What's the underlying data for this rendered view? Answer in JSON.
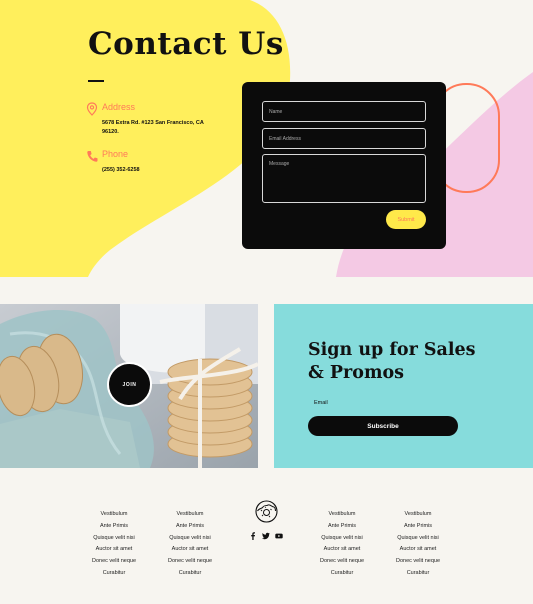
{
  "contact": {
    "title": "Contact Us",
    "address": {
      "label": "Address",
      "icon": "map-pin-icon",
      "line1": "5678 Extra Rd. #123 San Francisco, CA",
      "line2": "96120."
    },
    "phone": {
      "label": "Phone",
      "icon": "phone-icon",
      "number": "(255) 352-6258"
    },
    "form": {
      "name_placeholder": "Name",
      "email_placeholder": "Email Address",
      "message_placeholder": "Message",
      "submit_label": "Submit"
    }
  },
  "promo": {
    "join_label": "JOIN",
    "signup_title_line1": "Sign up for Sales",
    "signup_title_line2": "& Promos",
    "email_label": "Email",
    "subscribe_label": "Subscribe"
  },
  "footer": {
    "columns": [
      [
        "Vestibulum",
        "Ante Primis",
        "Quisque velit nisi",
        "Auctor sit amet",
        "Donec velit neque",
        "Curabitur"
      ],
      [
        "Vestibulum",
        "Ante Primis",
        "Quisque velit nisi",
        "Auctor sit amet",
        "Donec velit neque",
        "Curabitur"
      ],
      [
        "Vestibulum",
        "Ante Primis",
        "Quisque velit nisi",
        "Auctor sit amet",
        "Donec velit neque",
        "Curabitur"
      ],
      [
        "Vestibulum",
        "Ante Primis",
        "Quisque velit nisi",
        "Auctor sit amet",
        "Donec velit neque",
        "Curabitur"
      ]
    ],
    "social_icons": [
      "facebook-icon",
      "twitter-icon",
      "youtube-icon"
    ],
    "logo_icon": "donut-logo-icon"
  },
  "colors": {
    "yellow": "#ffef5c",
    "pink": "#f4c9e4",
    "orange": "#ff7a59",
    "teal": "#86dcdc",
    "black": "#0b0b0b"
  }
}
